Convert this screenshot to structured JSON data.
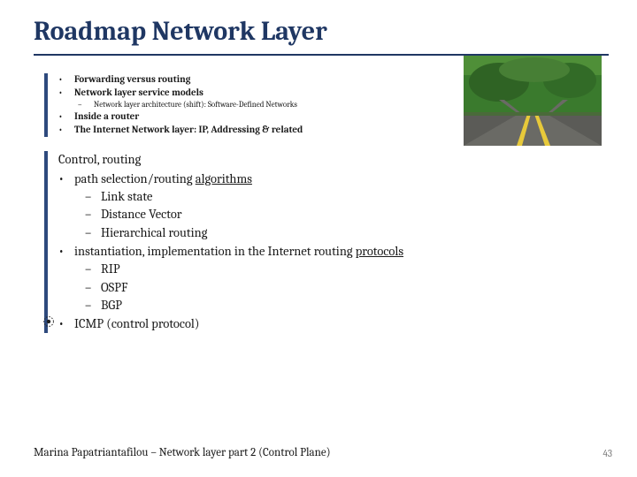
{
  "title": "Roadmap Network Layer",
  "top_bullets": [
    {
      "text": "Forwarding versus routing",
      "bold": true
    },
    {
      "text": "Network layer service models",
      "bold": true
    }
  ],
  "top_subdash": "Network layer architecture (shift): Software-Defined Networks",
  "top_bullets2": [
    {
      "text": "Inside a router",
      "bold": true
    },
    {
      "text": "The Internet Network layer: IP, Addressing & related",
      "bold": true
    }
  ],
  "bottom_heading": "Control, routing",
  "bottom_items": [
    {
      "label_pre": "path selection/routing ",
      "label_u": "algorithms",
      "sub": [
        "Link state",
        "Distance Vector",
        "Hierarchical routing"
      ]
    },
    {
      "label_pre": "instantiation, implementation in the Internet routing ",
      "label_u": "protocols",
      "sub": [
        "RIP",
        "OSPF",
        "BGP"
      ]
    },
    {
      "label_pre": "ICMP (control protocol)",
      "label_u": "",
      "sub": []
    }
  ],
  "footer": "Marina Papatriantafilou – Network layer part 2 (Control Plane)",
  "page": "43",
  "icons": {
    "bullet": "•",
    "dash": "–",
    "image_alt": "forked-road-photo"
  }
}
